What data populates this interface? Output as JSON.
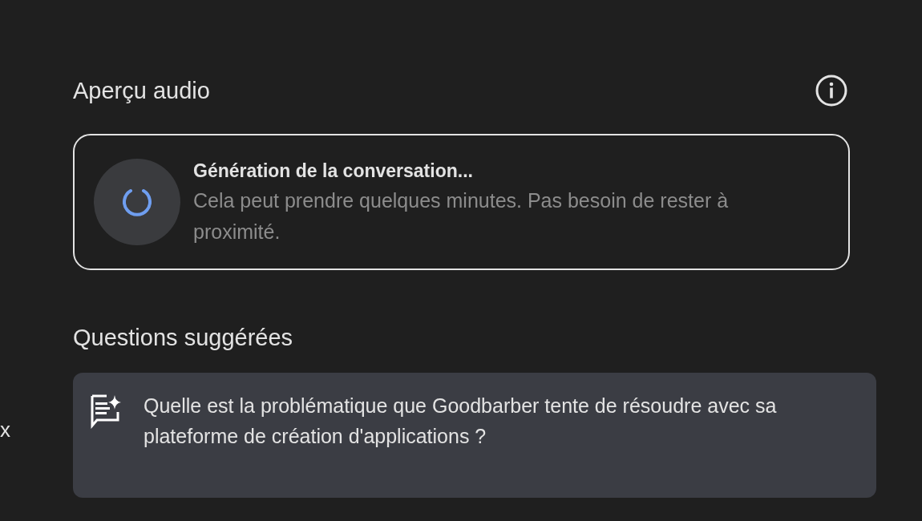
{
  "audio_overview": {
    "title": "Aperçu audio",
    "status": {
      "title": "Génération de la conversation...",
      "subtitle": "Cela peut prendre quelques minutes. Pas besoin de rester à proximité."
    }
  },
  "suggested_questions": {
    "title": "Questions suggérées",
    "edge_text": "x",
    "items": [
      {
        "text": "Quelle est la problématique que Goodbarber tente de résoudre avec sa plateforme de création d'applications ?"
      }
    ]
  }
}
